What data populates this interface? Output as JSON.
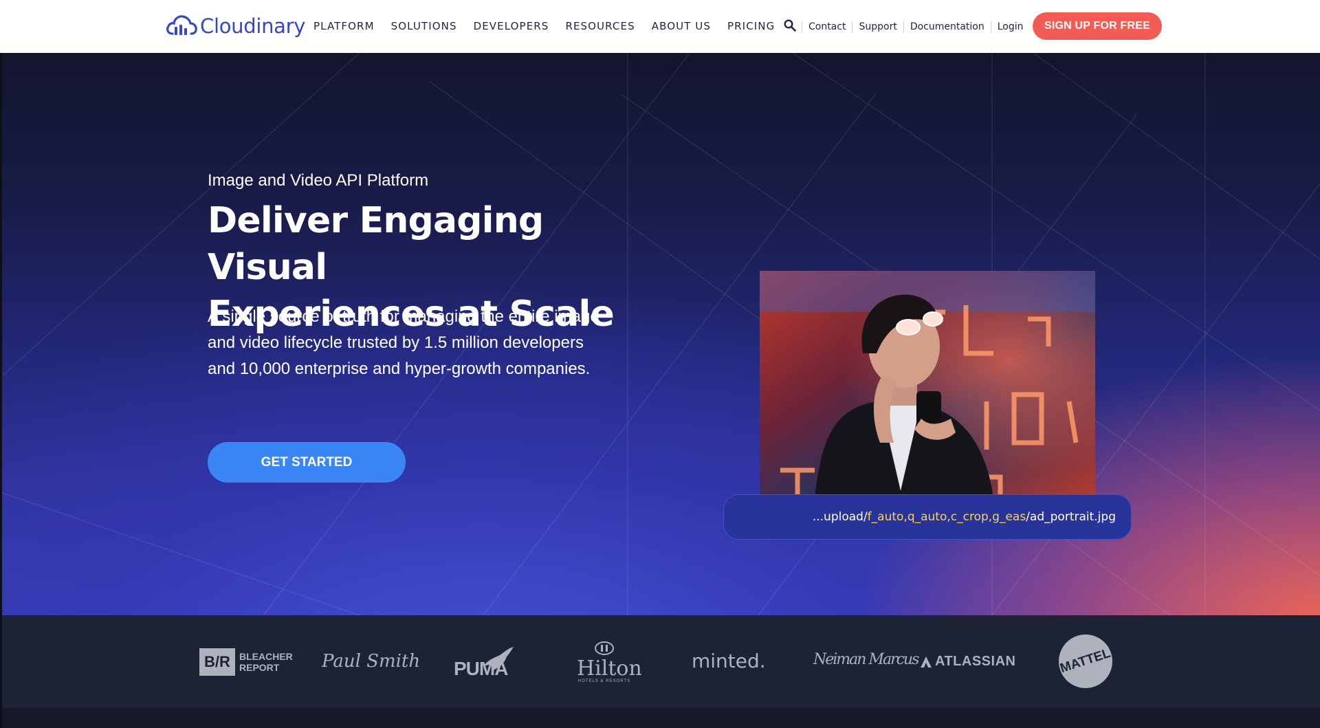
{
  "brand": {
    "name": "Cloudinary",
    "color": "#3448c5",
    "icon": "cloud-logo-icon"
  },
  "nav": {
    "items": [
      "PLATFORM",
      "SOLUTIONS",
      "DEVELOPERS",
      "RESOURCES",
      "ABOUT US",
      "PRICING"
    ],
    "search_icon": "search-icon",
    "utility": [
      "Contact",
      "Support",
      "Documentation",
      "Login"
    ],
    "signup_label": "SIGN UP FOR FREE",
    "signup_color": "#f25c54"
  },
  "hero": {
    "eyebrow": "Image and Video API Platform",
    "headline_line1": "Deliver Engaging Visual",
    "headline_line2": "Experiences at Scale",
    "subtext": "A single source of truth for managing the entire image and video lifecycle trusted by 1.5 million developers and 10,000 enterprise and hyper-growth companies.",
    "cta_label": "GET STARTED",
    "cta_color": "#3a86f5",
    "url": {
      "prefix": "...upload/",
      "params": "f_auto,q_auto,c_crop,g_eas",
      "suffix": "/ad_portrait.jpg"
    }
  },
  "customer_logos": [
    "BLEACHER REPORT",
    "Paul Smith",
    "PUMA",
    "Hilton",
    "minted.",
    "Neiman Marcus",
    "ATLASSIAN",
    "MATTEL"
  ],
  "customer_logos_sub": {
    "bleacher": [
      "BLEACHER",
      "REPORT"
    ],
    "hilton_sub": "HOTELS & RESORTS"
  }
}
